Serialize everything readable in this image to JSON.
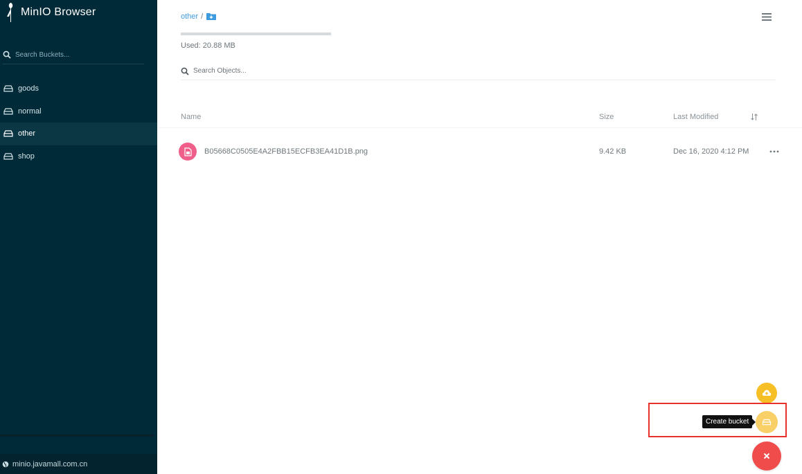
{
  "app": {
    "title": "MinIO Browser"
  },
  "sidebar": {
    "search_placeholder": "Search Buckets...",
    "buckets": [
      {
        "label": "goods",
        "active": false
      },
      {
        "label": "normal",
        "active": false
      },
      {
        "label": "other",
        "active": true
      },
      {
        "label": "shop",
        "active": false
      }
    ],
    "footer_host": "minio.javamall.com.cn"
  },
  "main": {
    "breadcrumb": {
      "bucket": "other",
      "separator": "/"
    },
    "usage_text": "Used: 20.88 MB",
    "search_placeholder": "Search Objects...",
    "columns": {
      "name": "Name",
      "size": "Size",
      "last_modified": "Last Modified"
    },
    "objects": [
      {
        "name": "B05668C0505E4A2FBB15ECFB3EA41D1B.png",
        "size": "9.42 KB",
        "modified": "Dec 16, 2020 4:12 PM"
      }
    ]
  },
  "fab": {
    "tooltip": "Create bucket"
  },
  "colors": {
    "sidebar_bg": "#002a37",
    "accent_link": "#3e9be0",
    "file_icon": "#ef5f8a",
    "fab_upload": "#f6bf26",
    "fab_bucket": "#f9cf67",
    "fab_close": "#f14c4c",
    "highlight": "#e8312a"
  },
  "icons": [
    "minio-logo-icon",
    "search-icon",
    "bucket-icon",
    "globe-icon",
    "add-folder-icon",
    "hamburger-menu-icon",
    "sort-icon",
    "image-file-icon",
    "more-dots-icon",
    "cloud-upload-icon",
    "close-icon"
  ]
}
